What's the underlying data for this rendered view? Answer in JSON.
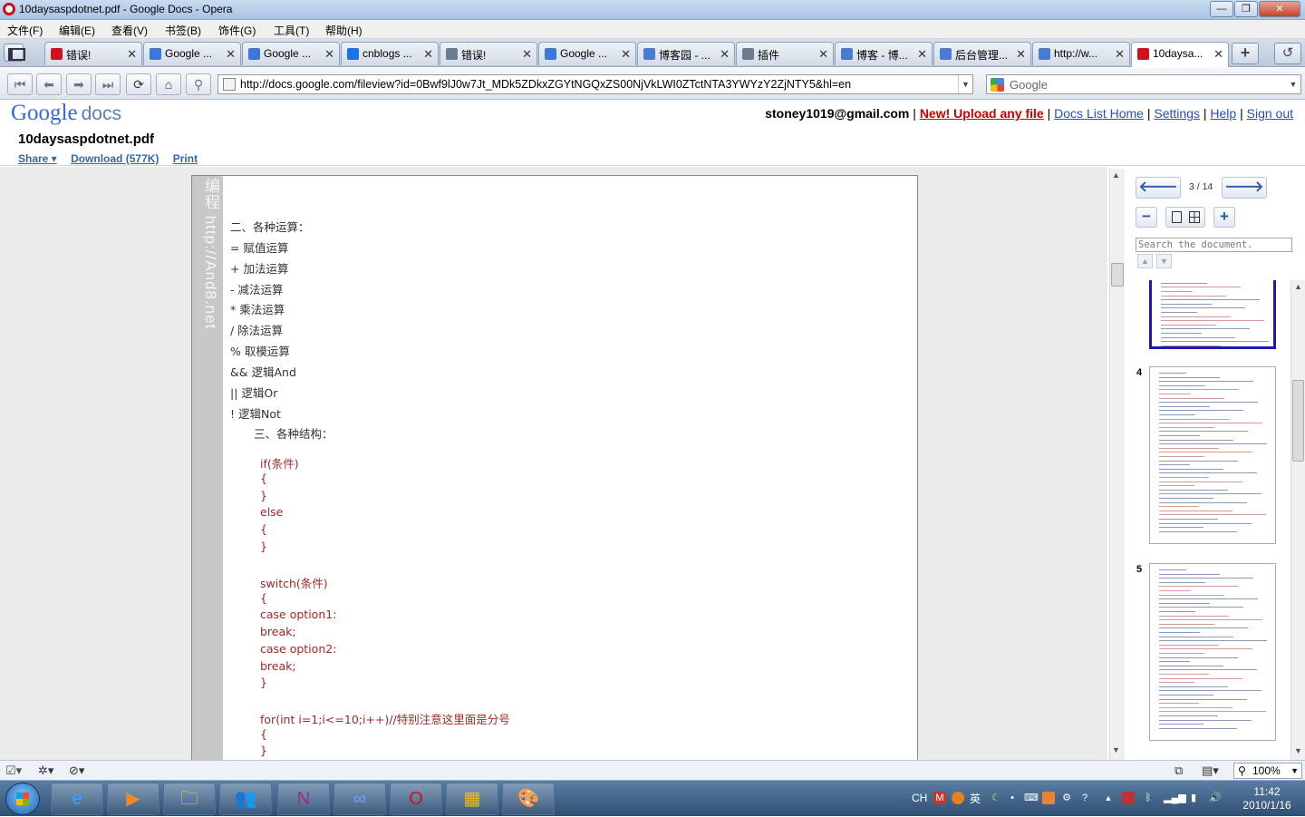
{
  "window": {
    "title": "10daysaspdotnet.pdf - Google Docs - Opera",
    "controls": [
      "—",
      "❐",
      "✕"
    ]
  },
  "menu": [
    "文件(F)",
    "编辑(E)",
    "查看(V)",
    "书签(B)",
    "饰件(G)",
    "工具(T)",
    "帮助(H)"
  ],
  "tabs": [
    {
      "label": "错误!",
      "icon_color": "#d0101a"
    },
    {
      "label": "Google ...",
      "icon_color": "#3c78d8"
    },
    {
      "label": "Google ...",
      "icon_color": "#3c78d8"
    },
    {
      "label": "cnblogs ...",
      "icon_color": "#1a73e8"
    },
    {
      "label": "错误!",
      "icon_color": "#6b7c8f"
    },
    {
      "label": "Google ...",
      "icon_color": "#3c78d8"
    },
    {
      "label": "博客园 - ...",
      "icon_color": "#4a7bd0"
    },
    {
      "label": "插件",
      "icon_color": "#6b7c8f"
    },
    {
      "label": "博客 - 博...",
      "icon_color": "#4a7bd0"
    },
    {
      "label": "后台管理...",
      "icon_color": "#4a7bd0"
    },
    {
      "label": "http://w...",
      "icon_color": "#4a7bd0"
    },
    {
      "label": "10daysa...",
      "icon_color": "#d0101a",
      "active": true
    }
  ],
  "tab_close": "✕",
  "new_tab": "+",
  "nav": {
    "url": "http://docs.google.com/fileview?id=0Bwf9lJ0w7Jt_MDk5ZDkxZGYtNGQxZS00NjVkLWI0ZTctNTA3YWYzY2ZjNTY5&hl=en",
    "search_placeholder": "Google"
  },
  "gdocs": {
    "logo_google": "Google",
    "logo_docs": "docs",
    "title": "10daysaspdotnet.pdf",
    "actions": {
      "share": "Share ▾",
      "download": "Download (577K)",
      "print": "Print"
    },
    "user": {
      "email": "stoney1019@gmail.com",
      "upload": "New! Upload any file",
      "docs_list": "Docs List Home",
      "settings": "Settings",
      "help": "Help",
      "signout": "Sign out"
    }
  },
  "document": {
    "watermark": "编程 http://And8.net",
    "lines": [
      {
        "text": "二、各种运算：",
        "color": "black"
      },
      {
        "text": "= 赋值运算",
        "color": "black"
      },
      {
        "text": "+ 加法运算",
        "color": "black"
      },
      {
        "text": "- 减法运算",
        "color": "black"
      },
      {
        "text": "* 乘法运算",
        "color": "black"
      },
      {
        "text": "/ 除法运算",
        "color": "black"
      },
      {
        "text": "% 取模运算",
        "color": "black"
      },
      {
        "text": "&& 逻辑And",
        "color": "black"
      },
      {
        "text": "|| 逻辑Or",
        "color": "black"
      },
      {
        "text": "! 逻辑Not",
        "color": "black"
      },
      {
        "text": "三、各种结构：",
        "color": "black"
      },
      {
        "text": "if(条件)",
        "color": "red"
      },
      {
        "text": "{",
        "color": "red"
      },
      {
        "text": "}",
        "color": "red"
      },
      {
        "text": "else",
        "color": "red"
      },
      {
        "text": "{",
        "color": "red"
      },
      {
        "text": "}",
        "color": "red"
      },
      {
        "text": "switch(条件)",
        "color": "red"
      },
      {
        "text": "{",
        "color": "red"
      },
      {
        "text": "case option1:",
        "color": "red"
      },
      {
        "text": "break;",
        "color": "red"
      },
      {
        "text": "case option2:",
        "color": "red"
      },
      {
        "text": "break;",
        "color": "red"
      },
      {
        "text": "}",
        "color": "red"
      },
      {
        "text": "for(int i=1;i<=10;i++)//特别注意这里面是分号",
        "color": "red"
      },
      {
        "text": "{",
        "color": "red"
      },
      {
        "text": "}",
        "color": "red"
      }
    ]
  },
  "viewer_panel": {
    "page_indicator": "3 / 14",
    "search_placeholder": "Search the document.",
    "thumbnails": [
      {
        "number": "",
        "current": true
      },
      {
        "number": "4",
        "current": false
      },
      {
        "number": "5",
        "current": false
      }
    ]
  },
  "statusbar": {
    "zoom": "100%"
  },
  "taskbar": {
    "apps": [
      "e",
      "▶",
      "🗀",
      "👥",
      "N",
      "∞",
      "O",
      "▦",
      "🎨"
    ],
    "tray_lang": "CH",
    "tray_ime": "英",
    "time": "11:42",
    "date": "2010/1/16"
  }
}
